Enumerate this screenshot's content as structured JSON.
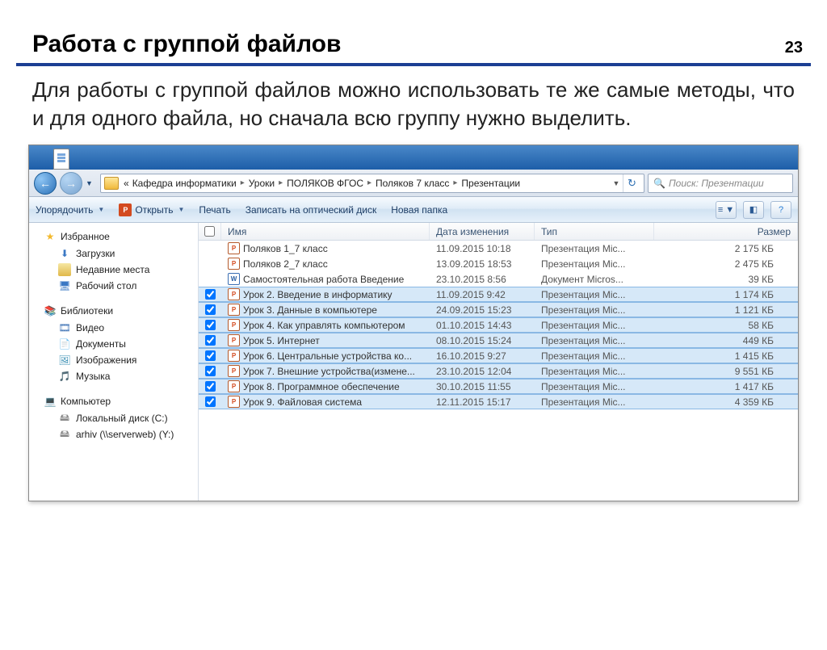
{
  "page_number": "23",
  "title": "Работа с группой файлов",
  "paragraph": "Для работы с группой файлов можно использовать те же самые методы, что и для одного файла, но сначала всю группу нужно выделить.",
  "breadcrumb": {
    "prefix": "«",
    "items": [
      "Кафедра информатики",
      "Уроки",
      "ПОЛЯКОВ ФГОС",
      "Поляков 7 класс",
      "Презентации"
    ]
  },
  "search_placeholder": "Поиск: Презентации",
  "toolbar": {
    "organize": "Упорядочить",
    "open": "Открыть",
    "print": "Печать",
    "burn": "Записать на оптический диск",
    "newfolder": "Новая папка"
  },
  "sidebar": {
    "fav_head": "Избранное",
    "fav": [
      "Загрузки",
      "Недавние места",
      "Рабочий стол"
    ],
    "lib_head": "Библиотеки",
    "lib": [
      "Видео",
      "Документы",
      "Изображения",
      "Музыка"
    ],
    "comp_head": "Компьютер",
    "comp": [
      "Локальный диск (C:)",
      "arhiv (\\\\serverweb) (Y:)"
    ]
  },
  "columns": {
    "name": "Имя",
    "date": "Дата изменения",
    "type": "Тип",
    "size": "Размер"
  },
  "files": [
    {
      "sel": false,
      "icon": "ppt",
      "name": "Поляков 1_7 класс",
      "date": "11.09.2015 10:18",
      "type": "Презентация Mic...",
      "size": "2 175 КБ"
    },
    {
      "sel": false,
      "icon": "ppt",
      "name": "Поляков 2_7 класс",
      "date": "13.09.2015 18:53",
      "type": "Презентация Mic...",
      "size": "2 475 КБ"
    },
    {
      "sel": false,
      "icon": "docx",
      "name": "Самостоятельная работа Введение",
      "date": "23.10.2015 8:56",
      "type": "Документ Micros...",
      "size": "39 КБ"
    },
    {
      "sel": true,
      "icon": "ppt",
      "name": "Урок 2. Введение в информатику",
      "date": "11.09.2015 9:42",
      "type": "Презентация Mic...",
      "size": "1 174 КБ"
    },
    {
      "sel": true,
      "icon": "ppt",
      "name": "Урок 3. Данные в компьютере",
      "date": "24.09.2015 15:23",
      "type": "Презентация Mic...",
      "size": "1 121 КБ"
    },
    {
      "sel": true,
      "icon": "ppt",
      "name": "Урок 4. Как управлять компьютером",
      "date": "01.10.2015 14:43",
      "type": "Презентация Mic...",
      "size": "58 КБ"
    },
    {
      "sel": true,
      "icon": "ppt",
      "name": "Урок 5. Интернет",
      "date": "08.10.2015 15:24",
      "type": "Презентация Mic...",
      "size": "449 КБ"
    },
    {
      "sel": true,
      "icon": "ppt",
      "name": "Урок 6. Центральные устройства ко...",
      "date": "16.10.2015 9:27",
      "type": "Презентация Mic...",
      "size": "1 415 КБ"
    },
    {
      "sel": true,
      "icon": "ppt",
      "name": "Урок 7. Внешние устройства(измене...",
      "date": "23.10.2015 12:04",
      "type": "Презентация Mic...",
      "size": "9 551 КБ"
    },
    {
      "sel": true,
      "icon": "ppt",
      "name": "Урок 8. Программное обеспечение",
      "date": "30.10.2015 11:55",
      "type": "Презентация Mic...",
      "size": "1 417 КБ"
    },
    {
      "sel": true,
      "icon": "ppt",
      "name": "Урок 9. Файловая система",
      "date": "12.11.2015 15:17",
      "type": "Презентация Mic...",
      "size": "4 359 КБ"
    }
  ]
}
